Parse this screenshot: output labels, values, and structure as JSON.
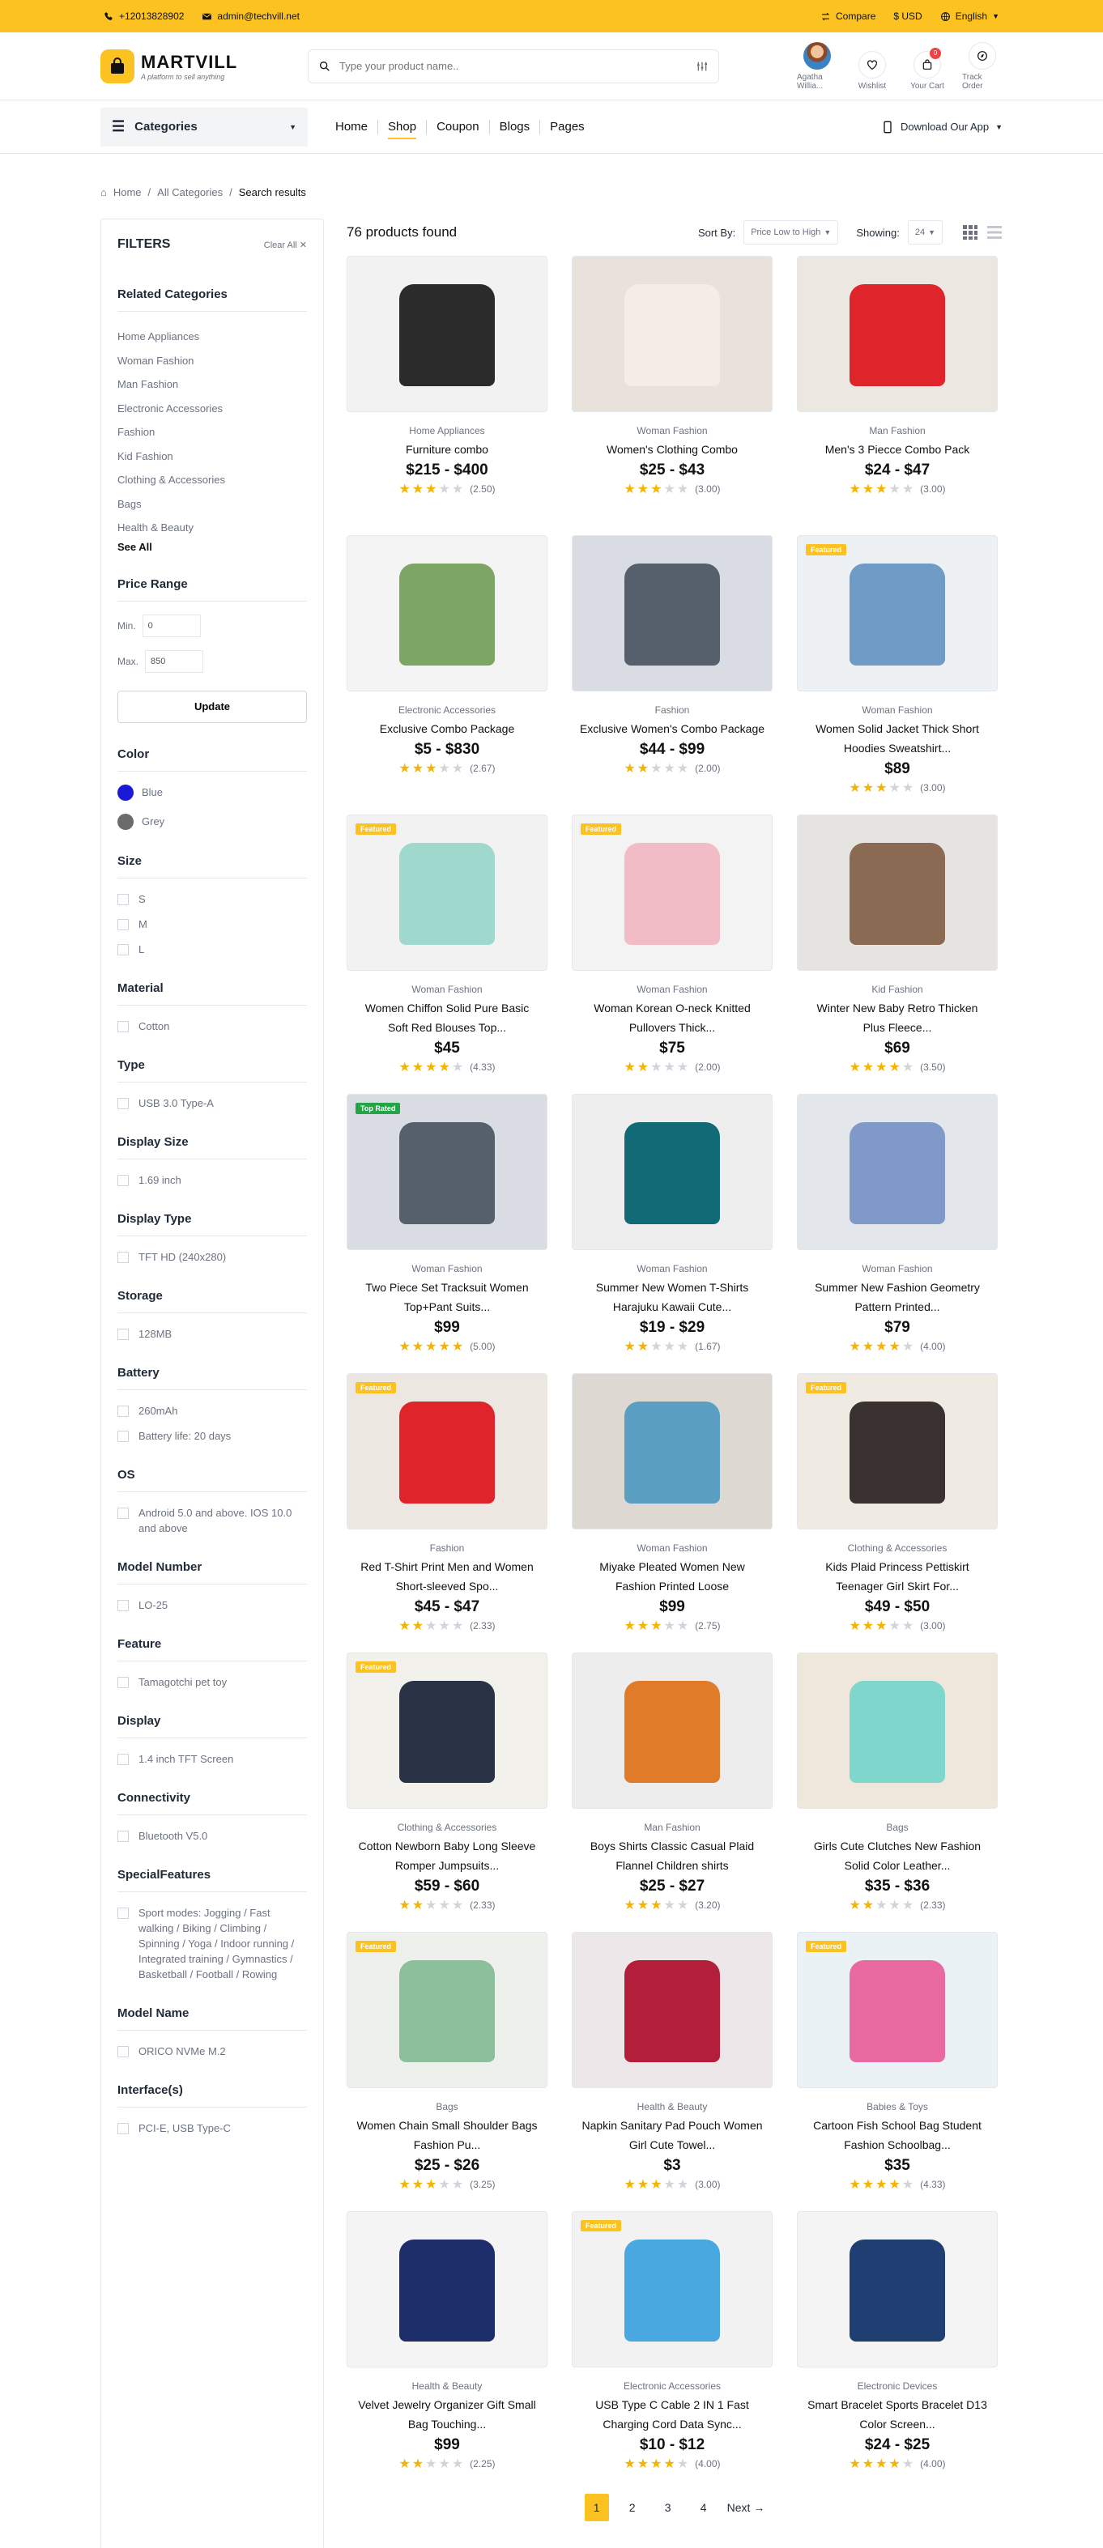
{
  "topbar": {
    "phone": "+12013828902",
    "email": "admin@techvill.net",
    "compare": "Compare",
    "currency": "$ USD",
    "language": "English"
  },
  "header": {
    "logo_name": "MARTVILL",
    "logo_tagline": "A platform to sell anything",
    "search_placeholder": "Type your product name..",
    "user_name": "Agatha Willia...",
    "wishlist": "Wishlist",
    "cart": "Your Cart",
    "cart_count": "0",
    "track": "Track Order"
  },
  "nav": {
    "categories": "Categories",
    "links": [
      "Home",
      "Shop",
      "Coupon",
      "Blogs",
      "Pages"
    ],
    "active": "Shop",
    "download": "Download Our App"
  },
  "breadcrumb": [
    "Home",
    "All Categories",
    "Search results"
  ],
  "filters": {
    "title": "FILTERS",
    "clear_all": "Clear All",
    "related_title": "Related Categories",
    "related": [
      "Home Appliances",
      "Woman Fashion",
      "Man Fashion",
      "Electronic Accessories",
      "Fashion",
      "Kid Fashion",
      "Clothing & Accessories",
      "Bags",
      "Health & Beauty"
    ],
    "see_all": "See All",
    "price_title": "Price Range",
    "min_label": "Min.",
    "min_value": "0",
    "max_label": "Max.",
    "max_value": "850",
    "update": "Update",
    "color_title": "Color",
    "colors": [
      {
        "name": "Blue",
        "hex": "#1a1ad6"
      },
      {
        "name": "Grey",
        "hex": "#6b6b6b"
      }
    ],
    "groups": [
      {
        "title": "Size",
        "options": [
          "S",
          "M",
          "L"
        ]
      },
      {
        "title": "Material",
        "options": [
          "Cotton"
        ]
      },
      {
        "title": "Type",
        "options": [
          "USB 3.0 Type-A"
        ]
      },
      {
        "title": "Display Size",
        "options": [
          "1.69 inch"
        ]
      },
      {
        "title": "Display Type",
        "options": [
          "TFT HD (240x280)"
        ]
      },
      {
        "title": "Storage",
        "options": [
          "128MB"
        ]
      },
      {
        "title": "Battery",
        "options": [
          "260mAh",
          "Battery life: 20 days"
        ]
      },
      {
        "title": "OS",
        "options": [
          "Android 5.0 and above. IOS 10.0 and above"
        ]
      },
      {
        "title": "Model Number",
        "options": [
          "LO-25"
        ]
      },
      {
        "title": "Feature",
        "options": [
          "Tamagotchi pet toy"
        ]
      },
      {
        "title": "Display",
        "options": [
          "1.4 inch TFT Screen"
        ]
      },
      {
        "title": "Connectivity",
        "options": [
          "Bluetooth V5.0"
        ]
      },
      {
        "title": "SpecialFeatures",
        "options": [
          "Sport modes: Jogging / Fast walking / Biking / Climbing / Spinning / Yoga / Indoor running / Integrated training / Gymnastics / Basketball / Football / Rowing"
        ]
      },
      {
        "title": "Model Name",
        "options": [
          "ORICO NVMe M.2"
        ]
      },
      {
        "title": "Interface(s)",
        "options": [
          "PCI-E, USB Type-C"
        ]
      }
    ]
  },
  "results": {
    "count_text": "76 products found",
    "sort_label": "Sort By:",
    "sort_value": "Price Low to High",
    "showing_label": "Showing:",
    "showing_value": "24"
  },
  "products": [
    {
      "category": "Home Appliances",
      "name": "Furniture combo",
      "price": "$215 - $400",
      "rating": 2.5,
      "rating_text": "(2.50)",
      "tag": "",
      "bg": "#f2f2f2",
      "fg": "#2b2b2b"
    },
    {
      "category": "Woman Fashion",
      "name": "Women's Clothing Combo",
      "price": "$25 - $43",
      "rating": 3.0,
      "rating_text": "(3.00)",
      "tag": "",
      "bg": "#e9e2da",
      "fg": "#f3ede5"
    },
    {
      "category": "Man Fashion",
      "name": "Men's 3 Piecce Combo Pack",
      "price": "$24 - $47",
      "rating": 3.0,
      "rating_text": "(3.00)",
      "tag": "",
      "bg": "#ece8e1",
      "fg": "#e0242b"
    },
    {
      "category": "Electronic Accessories",
      "name": "Exclusive Combo Package",
      "price": "$5 - $830",
      "rating": 2.67,
      "rating_text": "(2.67)",
      "tag": "",
      "bg": "#f4f4f4",
      "fg": "#7da563"
    },
    {
      "category": "Fashion",
      "name": "Exclusive Women's Combo Package",
      "price": "$44 - $99",
      "rating": 2.0,
      "rating_text": "(2.00)",
      "tag": "",
      "bg": "#d9dde3",
      "fg": "#56606c"
    },
    {
      "category": "Woman Fashion",
      "name": "Women Solid Jacket Thick Short Hoodies Sweatshirt...",
      "price": "$89",
      "rating": 3.0,
      "rating_text": "(3.00)",
      "tag": "Featured",
      "bg": "#eef1f4",
      "fg": "#6e9cc6"
    },
    {
      "category": "Woman Fashion",
      "name": "Women Chiffon Solid Pure Basic Soft Red Blouses Top...",
      "price": "$45",
      "rating": 4.33,
      "rating_text": "(4.33)",
      "tag": "Featured",
      "bg": "#f2f2f2",
      "fg": "#9fd8cd"
    },
    {
      "category": "Woman Fashion",
      "name": "Woman Korean O-neck Knitted Pullovers Thick...",
      "price": "$75",
      "rating": 2.0,
      "rating_text": "(2.00)",
      "tag": "Featured",
      "bg": "#f3f3f3",
      "fg": "#f2bcc6"
    },
    {
      "category": "Kid Fashion",
      "name": "Winter New Baby Retro Thicken Plus Fleece...",
      "price": "$69",
      "rating": 3.5,
      "rating_text": "(3.50)",
      "tag": "",
      "bg": "#e6e4e0",
      "fg": "#8a6a52"
    },
    {
      "category": "Woman Fashion",
      "name": "Two Piece Set Tracksuit Women Top+Pant Suits...",
      "price": "$99",
      "rating": 5.0,
      "rating_text": "(5.00)",
      "tag": "Top Rated",
      "bg": "#d9dde3",
      "fg": "#56606c"
    },
    {
      "category": "Woman Fashion",
      "name": "Summer New Women T-Shirts Harajuku Kawaii Cute...",
      "price": "$19 - $29",
      "rating": 1.67,
      "rating_text": "(1.67)",
      "tag": "",
      "bg": "#eeeeee",
      "fg": "#126a76"
    },
    {
      "category": "Woman Fashion",
      "name": "Summer New Fashion Geometry Pattern Printed...",
      "price": "$79",
      "rating": 4.0,
      "rating_text": "(4.00)",
      "tag": "",
      "bg": "#e3e7ec",
      "fg": "#7f9ac9"
    },
    {
      "category": "Fashion",
      "name": "Red T-Shirt Print Men and Women Short-sleeved Spo...",
      "price": "$45 - $47",
      "rating": 2.33,
      "rating_text": "(2.33)",
      "tag": "Featured",
      "bg": "#ece8e1",
      "fg": "#e0242b"
    },
    {
      "category": "Woman Fashion",
      "name": "Miyake Pleated Women New Fashion Printed Loose",
      "price": "$99",
      "rating": 2.75,
      "rating_text": "(2.75)",
      "tag": "",
      "bg": "#ddd8d2",
      "fg": "#5a9fc2"
    },
    {
      "category": "Clothing & Accessories",
      "name": "Kids Plaid Princess Pettiskirt Teenager Girl Skirt For...",
      "price": "$49 - $50",
      "rating": 3.0,
      "rating_text": "(3.00)",
      "tag": "Featured",
      "bg": "#efeae2",
      "fg": "#3a3230"
    },
    {
      "category": "Clothing & Accessories",
      "name": "Cotton Newborn Baby Long Sleeve Romper Jumpsuits...",
      "price": "$59 - $60",
      "rating": 2.33,
      "rating_text": "(2.33)",
      "tag": "Featured",
      "bg": "#f3f1ec",
      "fg": "#2a3245"
    },
    {
      "category": "Man Fashion",
      "name": "Boys Shirts Classic Casual Plaid Flannel Children shirts",
      "price": "$25 - $27",
      "rating": 3.2,
      "rating_text": "(3.20)",
      "tag": "",
      "bg": "#ededed",
      "fg": "#e07b2a"
    },
    {
      "category": "Bags",
      "name": "Girls Cute Clutches New Fashion Solid Color Leather...",
      "price": "$35 - $36",
      "rating": 2.33,
      "rating_text": "(2.33)",
      "tag": "",
      "bg": "#efe7dc",
      "fg": "#7fd6cc"
    },
    {
      "category": "Bags",
      "name": "Women Chain Small Shoulder Bags Fashion Pu...",
      "price": "$25 - $26",
      "rating": 3.25,
      "rating_text": "(3.25)",
      "tag": "Featured",
      "bg": "#eef0ec",
      "fg": "#8cbf9b"
    },
    {
      "category": "Health & Beauty",
      "name": "Napkin Sanitary Pad Pouch Women Girl Cute Towel...",
      "price": "$3",
      "rating": 3.0,
      "rating_text": "(3.00)",
      "tag": "",
      "bg": "#eee7ea",
      "fg": "#b31e3a"
    },
    {
      "category": "Babies & Toys",
      "name": "Cartoon Fish School Bag Student Fashion Schoolbag...",
      "price": "$35",
      "rating": 4.33,
      "rating_text": "(4.33)",
      "tag": "Featured",
      "bg": "#eaf2f5",
      "fg": "#e86aa0"
    },
    {
      "category": "Health & Beauty",
      "name": "Velvet Jewelry Organizer Gift Small Bag Touching...",
      "price": "$99",
      "rating": 2.25,
      "rating_text": "(2.25)",
      "tag": "",
      "bg": "#f4f4f4",
      "fg": "#1d2e6b"
    },
    {
      "category": "Electronic Accessories",
      "name": "USB Type C Cable 2 IN 1 Fast Charging Cord Data Sync...",
      "price": "$10 - $12",
      "rating": 4.0,
      "rating_text": "(4.00)",
      "tag": "Featured",
      "bg": "#f2f2f2",
      "fg": "#4aa8e0"
    },
    {
      "category": "Electronic Devices",
      "name": "Smart Bracelet Sports Bracelet D13 Color Screen...",
      "price": "$24 - $25",
      "rating": 4.0,
      "rating_text": "(4.00)",
      "tag": "",
      "bg": "#f4f4f4",
      "fg": "#1f3f73"
    }
  ],
  "pagination": {
    "pages": [
      "1",
      "2",
      "3",
      "4"
    ],
    "active": "1",
    "next": "Next →"
  },
  "colors": {
    "accent": "#fcc221",
    "star": "#f5b400"
  }
}
